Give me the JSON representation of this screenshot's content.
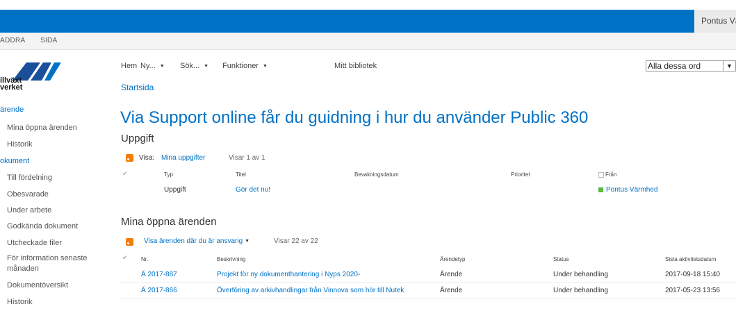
{
  "topbar": {
    "user_name": "Pontus Vä"
  },
  "ribbon": {
    "tab1": "ADDRA",
    "tab2": "SIDA"
  },
  "logo": {
    "line1": "illväxt",
    "line2": "verket"
  },
  "sidebar": {
    "arenden_head": "ärende",
    "mina_oppna": "Mina öppna ärenden",
    "historik1": "Historik",
    "dokument_head": "okument",
    "till_fordelning": "Till fördelning",
    "obesvarade": "Obesvarade",
    "under_arbete": "Under arbete",
    "godkanda": "Godkända dokument",
    "utcheckade": "Utcheckade filer",
    "for_info_1": "För information senaste",
    "for_info_2": "månaden",
    "dokumentoversikt": "Dokumentöversikt",
    "historik2": "Historik"
  },
  "nav": {
    "hem": "Hem",
    "ny": "Ny...",
    "sok": "Sök...",
    "funktioner": "Funktioner",
    "mitt_bibliotek": "Mitt bibliotek"
  },
  "search": {
    "selected": "Alla dessa ord"
  },
  "breadcrumb": "Startsida",
  "main_title": "Via Support online får du guidning i hur du använder Public 360",
  "tasks": {
    "title": "Uppgift",
    "visa_label": "Visa:",
    "visa_link": "Mina uppgifter",
    "count": "Visar 1 av 1",
    "headers": {
      "typ": "Typ",
      "titel": "Titel",
      "bevakning": "Bevakningsdatum",
      "prioritet": "Prioritet",
      "fran": "Från"
    },
    "rows": [
      {
        "typ": "Uppgift",
        "titel": "Gör det nu!",
        "fran": "Pontus Värmhed"
      }
    ]
  },
  "cases": {
    "title": "Mina öppna ärenden",
    "filter": "Visa ärenden där du är ansvarig",
    "count": "Visar 22 av 22",
    "headers": {
      "nr": "Nr.",
      "beskrivning": "Beskrivning",
      "arendetyp": "Ärendetyp",
      "status": "Status",
      "sista": "Sista aktivitetsdatum"
    },
    "rows": [
      {
        "nr": "Ä 2017-887",
        "beskrivning": "Projekt för ny dokumenthantering i Nyps 2020-",
        "typ": "Ärende",
        "status": "Under behandling",
        "datum": "2017-09-18 15:40"
      },
      {
        "nr": "Ä 2017-866",
        "beskrivning": "Överföring av arkivhandlingar från Vinnova som hör till Nutek",
        "typ": "Ärende",
        "status": "Under behandling",
        "datum": "2017-05-23 13:56"
      }
    ]
  },
  "colors": {
    "brand_blue": "#0072c6",
    "rss_orange": "#f57d00",
    "presence_green": "#5ab83c"
  }
}
